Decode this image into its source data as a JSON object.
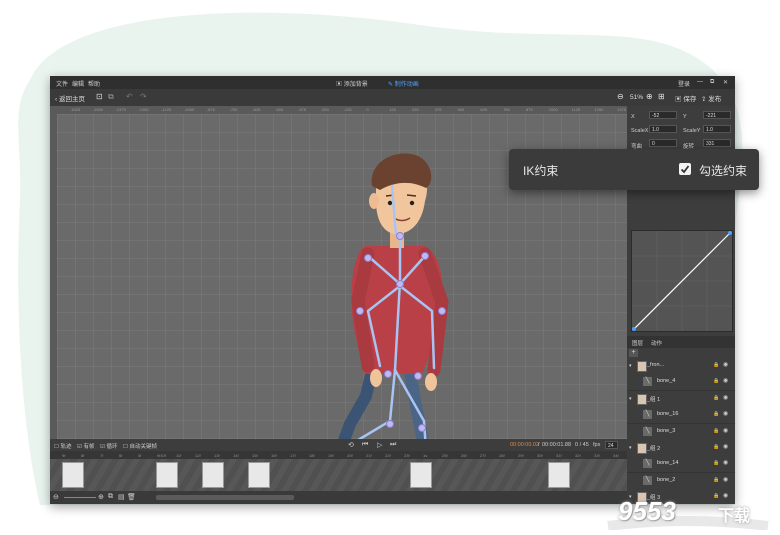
{
  "menu": {
    "file": "文件",
    "edit": "编辑",
    "help": "帮助"
  },
  "tabs": {
    "add_bg": "添加背景",
    "make_anim": "制作动画"
  },
  "account": {
    "login": "登录"
  },
  "toolbar": {
    "back": "返回主页",
    "zoom": "51%",
    "save": "保存",
    "publish": "发布"
  },
  "ruler_top": [
    "-1625",
    "-1500",
    "-1375",
    "-1250",
    "-1125",
    "-1000",
    "-875",
    "-750",
    "-625",
    "-500",
    "-375",
    "-250",
    "-125",
    "0",
    "125",
    "250",
    "375",
    "500",
    "625",
    "750",
    "875",
    "1000",
    "1125",
    "1250",
    "1375"
  ],
  "ruler_left": [
    "850",
    "750",
    "650",
    "550",
    "450",
    "350",
    "250",
    "150",
    "50",
    "-50",
    "-150",
    "-250",
    "-350"
  ],
  "props": {
    "x_label": "X",
    "x_value": "-52",
    "y_label": "Y",
    "y_value": "-221",
    "scalex_label": "ScaleX",
    "scalex_value": "1.0",
    "scaley_label": "ScaleY",
    "scaley_value": "1.0",
    "skew_label": "弯曲",
    "skew_value": "0",
    "rotate_label": "旋转",
    "rotate_value": "331"
  },
  "popup": {
    "title": "IK约束",
    "check_label": "勾选约束"
  },
  "layer_tabs": {
    "layers": "图层",
    "actions": "动作"
  },
  "layers": [
    {
      "name": "_fron...",
      "kind": "group"
    },
    {
      "name": "bone_4",
      "kind": "bone"
    },
    {
      "name": "_组 1",
      "kind": "group"
    },
    {
      "name": "bone_16",
      "kind": "bone"
    },
    {
      "name": "bone_3",
      "kind": "bone"
    },
    {
      "name": "_组 2",
      "kind": "group"
    },
    {
      "name": "bone_14",
      "kind": "bone"
    },
    {
      "name": "bone_2",
      "kind": "bone"
    },
    {
      "name": "_组 3",
      "kind": "group"
    },
    {
      "name": "bone_6",
      "kind": "bone"
    }
  ],
  "timeline": {
    "track_label": "轨迹",
    "has_frames_label": "有帧",
    "loop_label": "循环",
    "auto_keyframe_label": "自动关键帧",
    "current_time": "00:00:00.02",
    "total_time": "00:00:01.88",
    "frame_counter": "0 / 45",
    "fps_label": "fps",
    "fps_value": "24",
    "ruler": [
      "9f",
      "8f",
      "7f",
      "6f",
      "5f",
      "9f10f",
      "11f",
      "12f",
      "13f",
      "14f",
      "15f",
      "16f",
      "17f",
      "18f",
      "19f",
      "20f",
      "21f",
      "22f",
      "23f",
      "1s",
      "25f",
      "26f",
      "27f",
      "28f",
      "29f",
      "30f",
      "31f",
      "32f",
      "33f",
      "34f"
    ]
  },
  "watermark": {
    "text": "9553",
    "sub": "下载"
  },
  "colors": {
    "accent": "#4aa3ff",
    "bone": "#a9c4f2",
    "shirt": "#b84046",
    "orange_time": "#e08a3a"
  }
}
